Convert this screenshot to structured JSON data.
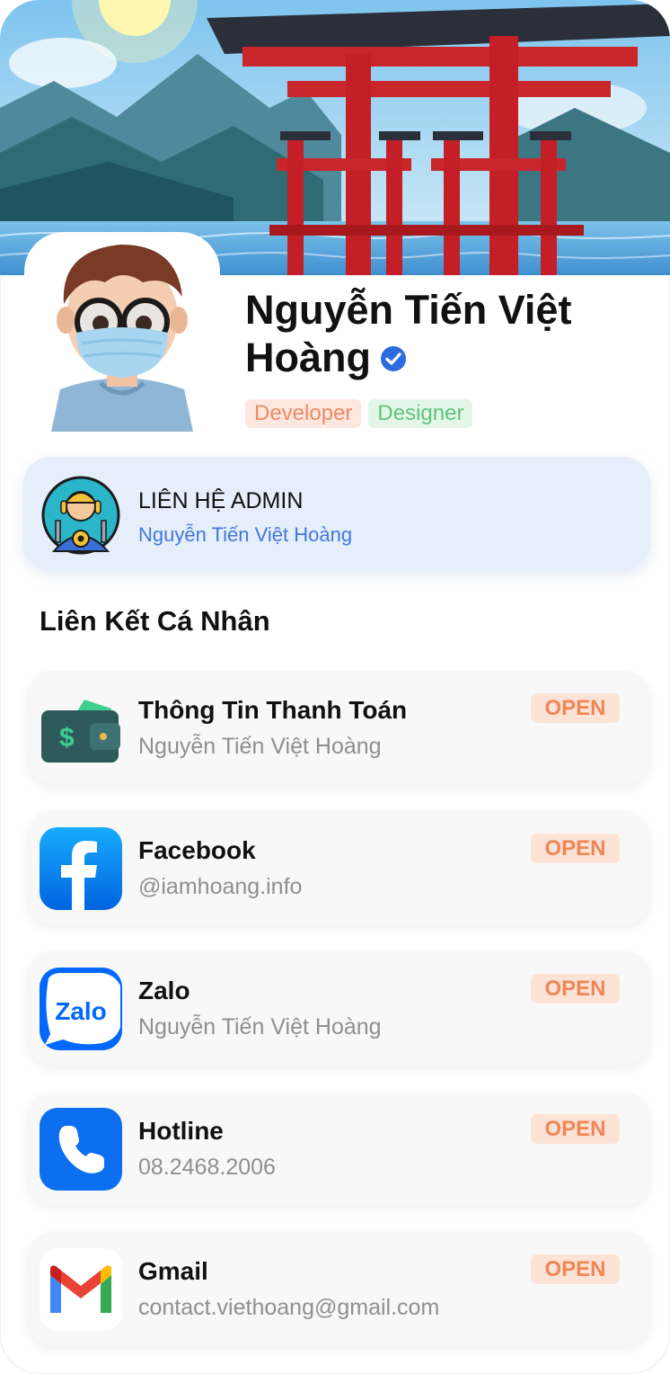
{
  "profile": {
    "name": "Nguyễn Tiến Việt Hoàng",
    "tags": [
      "Developer",
      "Designer"
    ]
  },
  "admin": {
    "title": "LIÊN HỆ ADMIN",
    "subtitle": "Nguyễn Tiến Việt Hoàng"
  },
  "section": {
    "title": "Liên Kết Cá Nhân"
  },
  "links": [
    {
      "icon": "wallet-icon",
      "title": "Thông Tin Thanh Toán",
      "subtitle": "Nguyễn Tiến Việt Hoàng",
      "button": "OPEN"
    },
    {
      "icon": "facebook-icon",
      "title": "Facebook",
      "subtitle": "@iamhoang.info",
      "button": "OPEN"
    },
    {
      "icon": "zalo-icon",
      "title": "Zalo",
      "subtitle": "Nguyễn Tiến Việt Hoàng",
      "button": "OPEN"
    },
    {
      "icon": "phone-icon",
      "title": "Hotline",
      "subtitle": "08.2468.2006",
      "button": "OPEN"
    },
    {
      "icon": "gmail-icon",
      "title": "Gmail",
      "subtitle": "contact.viethoang@gmail.com",
      "button": "OPEN"
    }
  ],
  "colors": {
    "accent": "#3f78df",
    "open_bg": "#fde3d6",
    "open_text": "#f08656",
    "admin_bg": "#e6eefb"
  }
}
